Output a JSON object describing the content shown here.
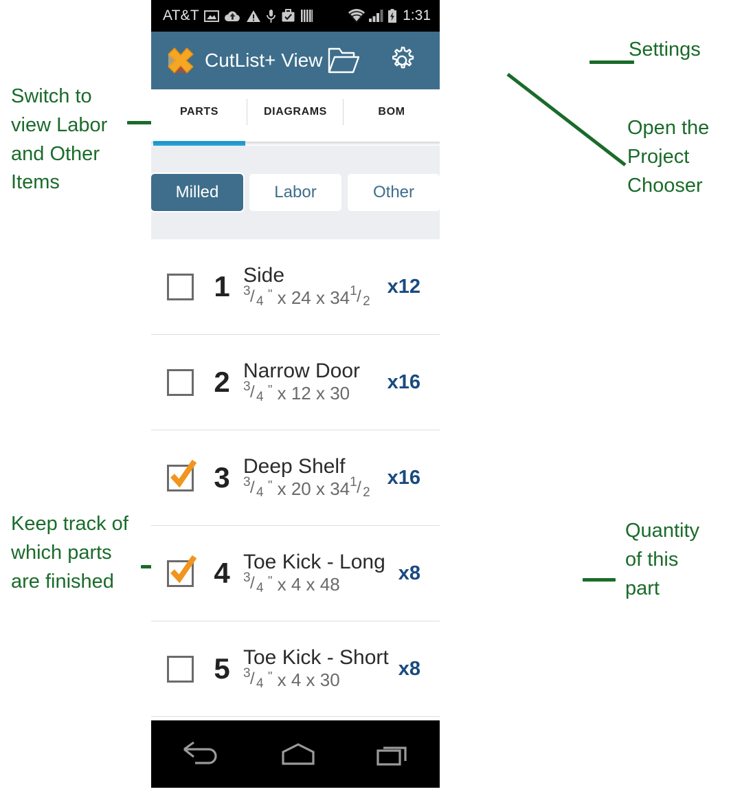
{
  "statusbar": {
    "carrier": "AT&T",
    "clock": "1:31",
    "left_icons": [
      "image-icon",
      "cloud-upload-icon",
      "warning-icon",
      "microphone-icon",
      "briefcase-check-icon",
      "barcode-icon"
    ],
    "right_icons": [
      "wifi-icon",
      "signal-icon",
      "battery-charging-icon"
    ]
  },
  "appbar": {
    "title": "CutList+ View",
    "logo": "cutlist-x-logo",
    "actions": [
      {
        "name": "open-folder-icon",
        "label": "Open Project Chooser"
      },
      {
        "name": "gear-icon",
        "label": "Settings"
      }
    ]
  },
  "tabs": {
    "items": [
      {
        "label": "PARTS",
        "selected": true
      },
      {
        "label": "DIAGRAMS",
        "selected": false
      },
      {
        "label": "BOM",
        "selected": false
      }
    ]
  },
  "segmented": {
    "options": [
      {
        "label": "Milled",
        "selected": true
      },
      {
        "label": "Labor",
        "selected": false
      },
      {
        "label": "Other",
        "selected": false
      }
    ]
  },
  "parts": {
    "rows": [
      {
        "num": "1",
        "name": "Side",
        "thick_num": "3",
        "thick_den": "4",
        "dims": "x 24 x 34",
        "frac2_num": "1",
        "frac2_den": "2",
        "qty": "x12",
        "checked": false
      },
      {
        "num": "2",
        "name": "Narrow Door",
        "thick_num": "3",
        "thick_den": "4",
        "dims": "x 12 x 30",
        "frac2_num": "",
        "frac2_den": "",
        "qty": "x16",
        "checked": false
      },
      {
        "num": "3",
        "name": "Deep Shelf",
        "thick_num": "3",
        "thick_den": "4",
        "dims": "x 20 x 34",
        "frac2_num": "1",
        "frac2_den": "2",
        "qty": "x16",
        "checked": true
      },
      {
        "num": "4",
        "name": "Toe Kick - Long",
        "thick_num": "3",
        "thick_den": "4",
        "dims": "x 4 x 48",
        "frac2_num": "",
        "frac2_den": "",
        "qty": "x8",
        "checked": true
      },
      {
        "num": "5",
        "name": "Toe Kick - Short",
        "thick_num": "3",
        "thick_den": "4",
        "dims": "x 4 x 30",
        "frac2_num": "",
        "frac2_den": "",
        "qty": "x8",
        "checked": false
      }
    ],
    "inch_mark": "\""
  },
  "navbar": {
    "items": [
      "back-icon",
      "home-icon",
      "recents-icon"
    ]
  },
  "annotations": {
    "switch_labor": "Switch to\nview Labor\nand Other\nItems",
    "settings": "Settings",
    "project_chooser": "Open the\nProject\nChooser",
    "keep_track": "Keep track of\nwhich parts\nare finished",
    "quantity": "Quantity\nof this\npart"
  },
  "colors": {
    "appbar": "#3e6e8b",
    "tab_underline": "#29a8df",
    "annotation": "#1a6b2a",
    "quantity": "#1a4a80",
    "check": "#f0951e",
    "segment_bg": "#edeef2"
  }
}
